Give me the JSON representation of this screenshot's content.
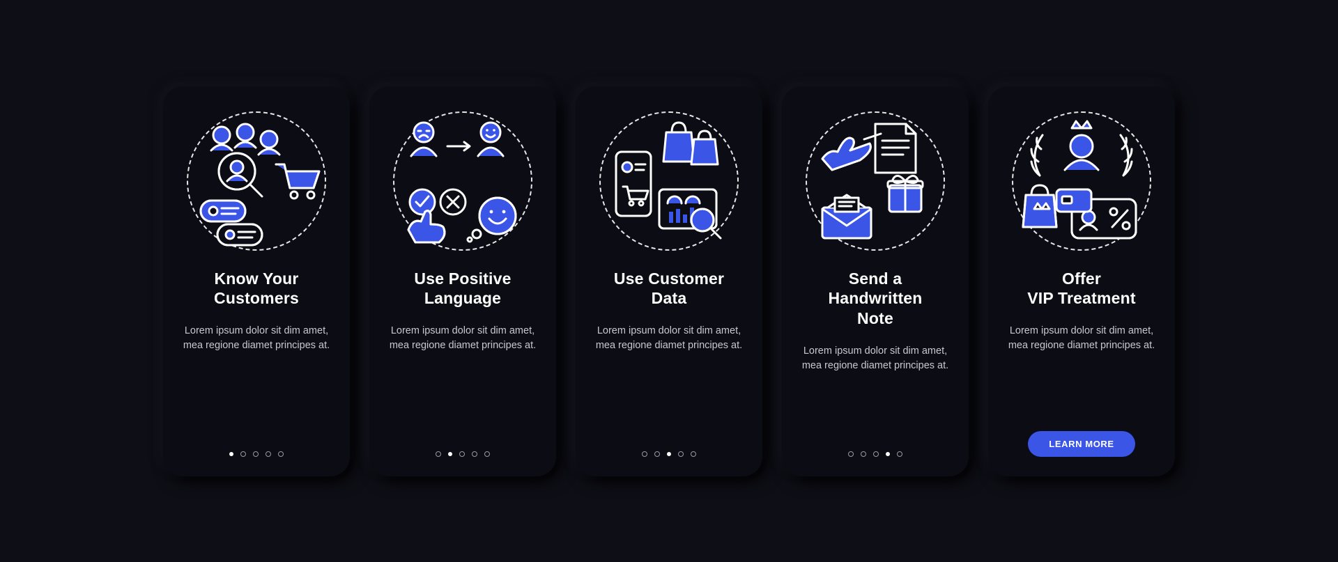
{
  "accent": "#3b55e6",
  "stroke": "#ffffff",
  "cta_label": "LEARN MORE",
  "body_text": "Lorem ipsum dolor sit dim amet, mea regione diamet principes at.",
  "slides": [
    {
      "id": "know-customers",
      "title_line1": "Know Your",
      "title_line2": "Customers",
      "active_dot": 0,
      "icon_semantic": "customers-research-icon"
    },
    {
      "id": "positive-language",
      "title_line1": "Use Positive",
      "title_line2": "Language",
      "active_dot": 1,
      "icon_semantic": "positive-language-icon"
    },
    {
      "id": "customer-data",
      "title_line1": "Use Customer",
      "title_line2": "Data",
      "active_dot": 2,
      "icon_semantic": "customer-data-analytics-icon"
    },
    {
      "id": "handwritten-note",
      "title_line1": "Send a",
      "title_line2": "Handwritten",
      "title_line3": "Note",
      "active_dot": 3,
      "icon_semantic": "handwritten-note-gift-icon"
    },
    {
      "id": "vip-treatment",
      "title_line1": "Offer",
      "title_line2": "VIP Treatment",
      "active_dot": null,
      "icon_semantic": "vip-crown-card-icon",
      "show_cta": true
    }
  ]
}
